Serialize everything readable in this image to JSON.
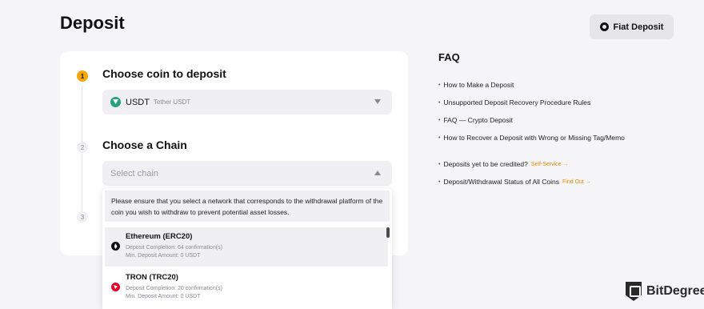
{
  "header": {
    "title": "Deposit",
    "fiat_button": "Fiat Deposit"
  },
  "steps": [
    {
      "num": "1",
      "title": "Choose coin to deposit"
    },
    {
      "num": "2",
      "title": "Choose a Chain"
    },
    {
      "num": "3",
      "title": ""
    }
  ],
  "coin_select": {
    "value": "USDT",
    "sub": "Tether USDT",
    "icon": "usdt-icon"
  },
  "chain_select": {
    "placeholder": "Select chain"
  },
  "dropdown": {
    "notice": "Please ensure that you select a network that corresponds to the withdrawal platform of the coin you wish to withdraw to prevent potential asset losses.",
    "chains": [
      {
        "name": "Ethereum (ERC20)",
        "completion": "Deposit Completion: 64 confirmation(s)",
        "min": "Min. Deposit Amount: 0 USDT",
        "icon": "ethereum-icon"
      },
      {
        "name": "TRON (TRC20)",
        "completion": "Deposit Completion: 20 confirmation(s)",
        "min": "Min. Deposit Amount: 0 USDT",
        "icon": "tron-icon"
      }
    ]
  },
  "faq": {
    "title": "FAQ",
    "items": [
      "How to Make a Deposit",
      "Unsupported Deposit Recovery Procedure Rules",
      "FAQ — Crypto Deposit",
      "How to Recover a Deposit with Wrong or Missing Tag/Memo"
    ],
    "credit_q": "Deposits yet to be credited?",
    "credit_link": "Self-Service →",
    "status_q": "Deposit/Withdrawal Status of All Coins",
    "status_link": "Find Out →"
  },
  "brand": {
    "name": "BitDegree"
  },
  "colors": {
    "accent": "#f6a609",
    "link": "#e08a00",
    "usdt": "#26a17b",
    "tron": "#eb0029"
  }
}
